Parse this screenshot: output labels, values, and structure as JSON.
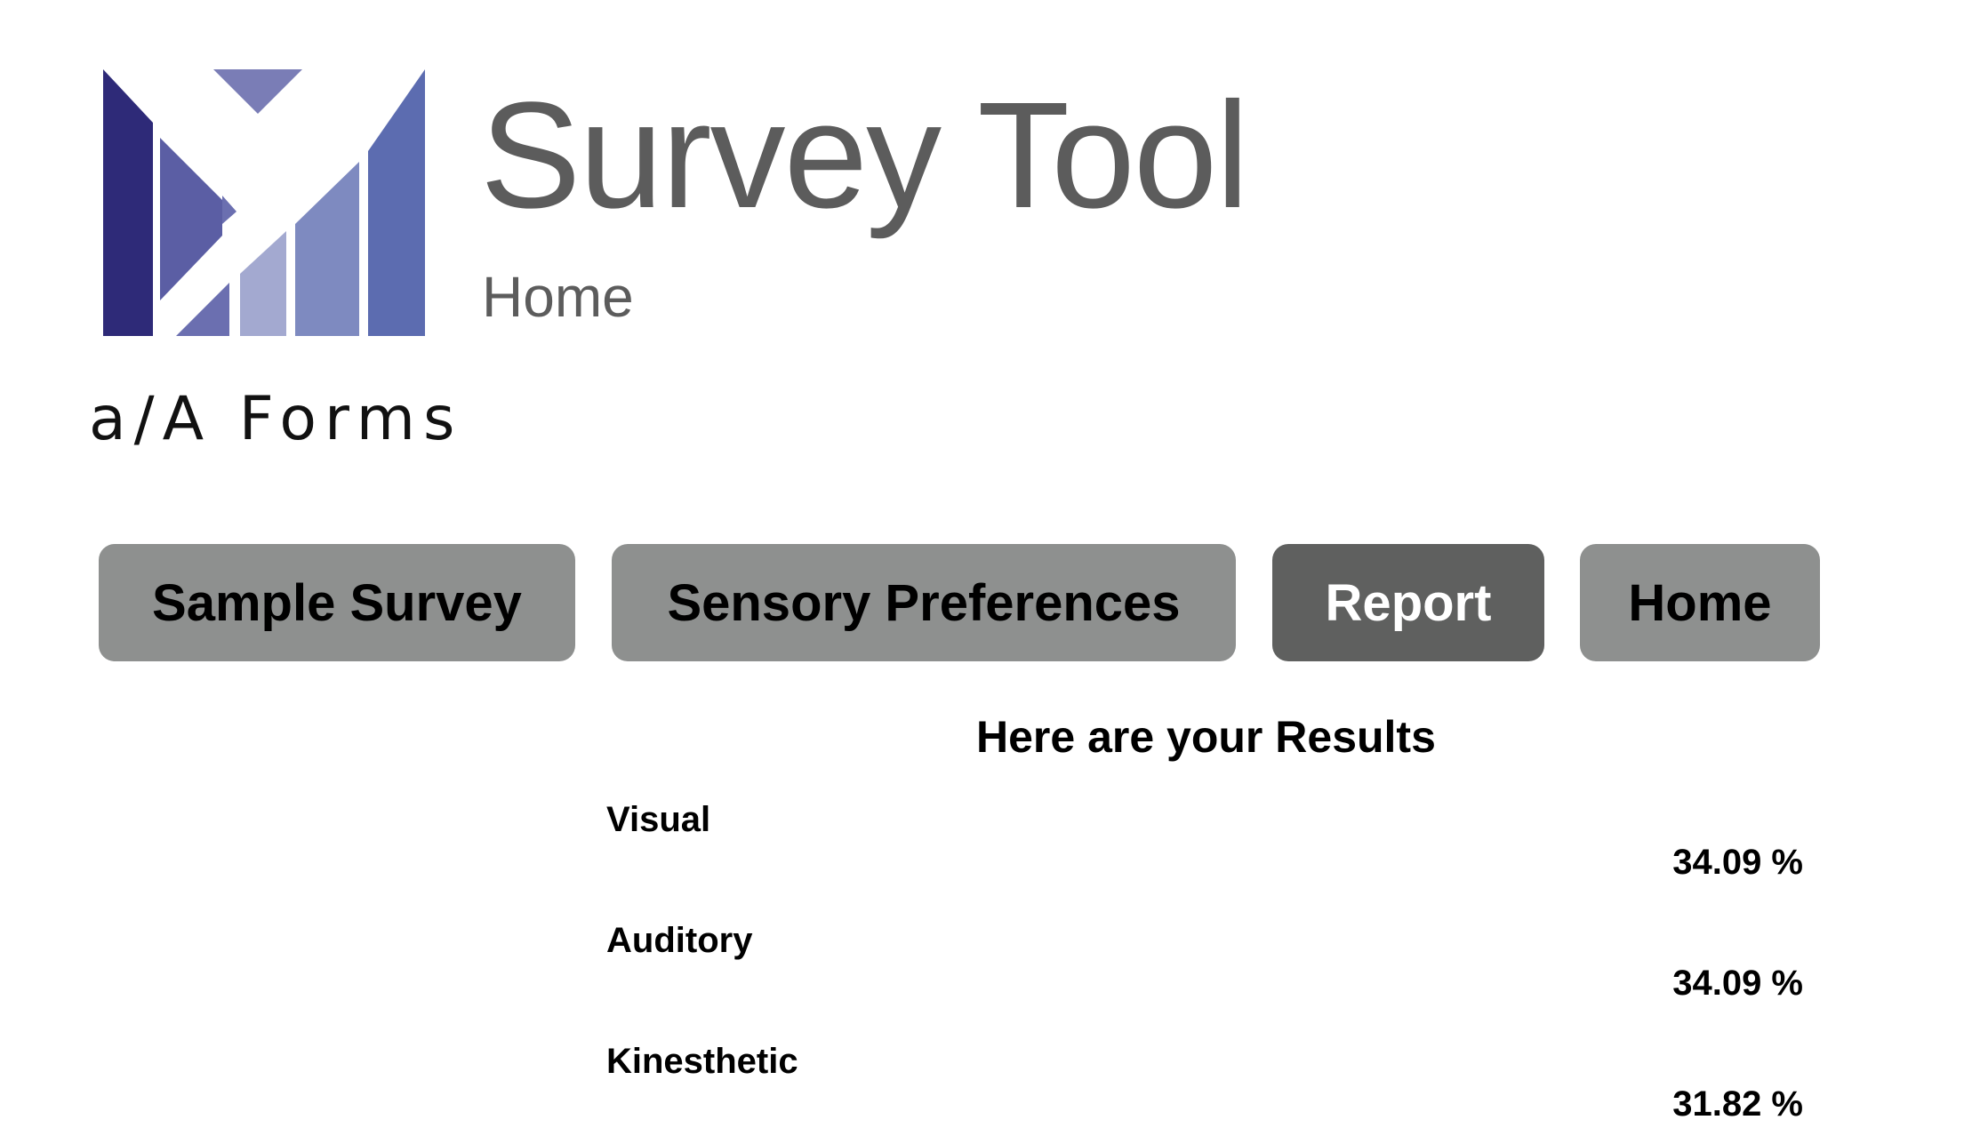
{
  "logo": {
    "text": "a/A Forms",
    "colors": [
      "#2e2a78",
      "#5b5ea4",
      "#6b6fb0",
      "#a3a9d0",
      "#7e8ac0",
      "#5c6cb0",
      "#7a7db6"
    ]
  },
  "header": {
    "title": "Survey Tool",
    "subtitle": "Home"
  },
  "nav": {
    "items": [
      {
        "label": "Sample Survey",
        "active": false
      },
      {
        "label": "Sensory Preferences",
        "active": false
      },
      {
        "label": "Report",
        "active": true
      },
      {
        "label": "Home",
        "active": false
      }
    ],
    "colors": {
      "default": "#8e908f",
      "active": "#5f605f"
    }
  },
  "results": {
    "title": "Here are your Results",
    "items": [
      {
        "label": "Visual",
        "value": "34.09 %"
      },
      {
        "label": "Auditory",
        "value": "34.09 %"
      },
      {
        "label": "Kinesthetic",
        "value": "31.82 %"
      }
    ]
  }
}
